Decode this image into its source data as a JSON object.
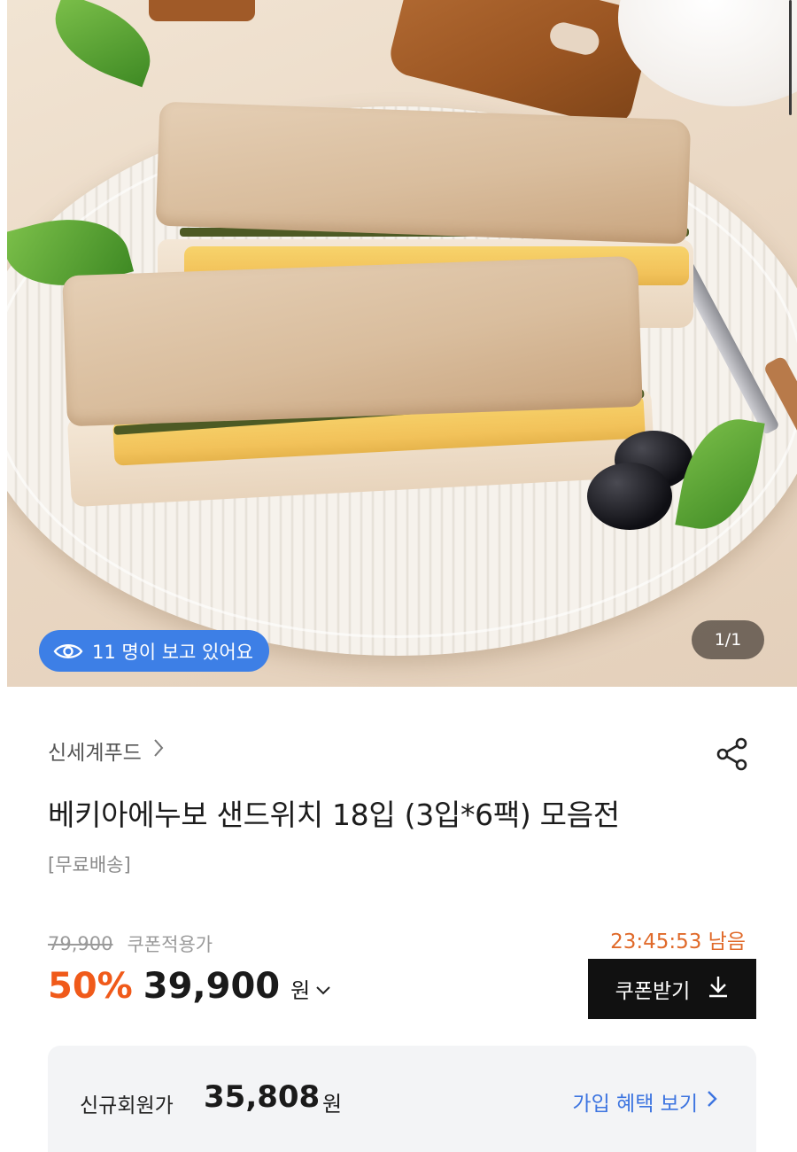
{
  "gallery": {
    "viewers_text": "11 명이 보고 있어요",
    "image_counter": "1/1"
  },
  "product": {
    "brand": "신세계푸드",
    "title": "베키아에누보 샌드위치 18입 (3입*6팩) 모음전",
    "shipping": "[무료배송]"
  },
  "pricing": {
    "original_price": "79,900",
    "coupon_note": "쿠폰적용가",
    "timer": "23:45:53 남음",
    "discount": "50%",
    "price": "39,900",
    "currency": "원"
  },
  "coupon_button": {
    "label": "쿠폰받기"
  },
  "member_box": {
    "label": "신규회원가",
    "price": "35,808",
    "currency": "원",
    "link_label": "가입 혜택 보기"
  },
  "colors": {
    "accent_orange": "#f05a1a",
    "timer_orange": "#e06a2a",
    "viewers_blue": "#3d7fe6",
    "link_blue": "#3c74e0"
  },
  "icons": [
    "eye-icon",
    "chevron-right-icon",
    "share-icon",
    "chevron-down-icon",
    "download-icon"
  ]
}
